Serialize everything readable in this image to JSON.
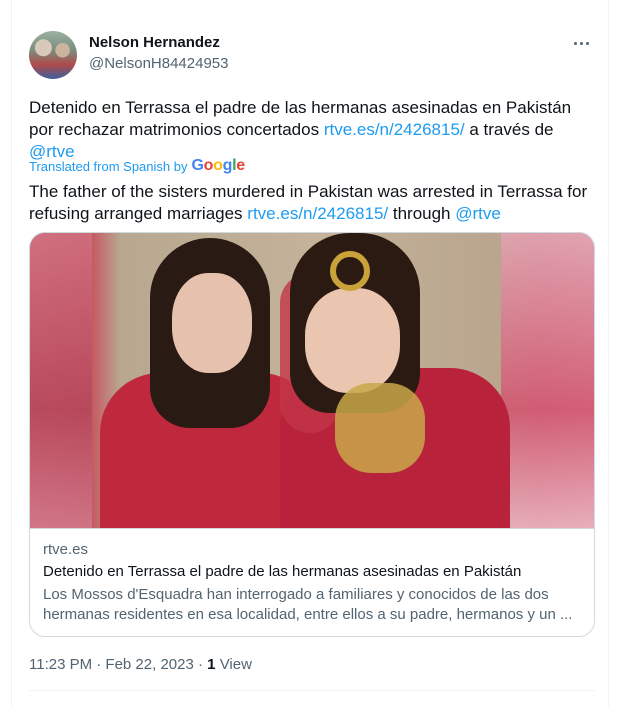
{
  "author": {
    "name": "Nelson Hernandez",
    "handle": "@NelsonH84424953"
  },
  "tweet": {
    "original_text": "Detenido en Terrassa el padre de las hermanas asesinadas en Pakistán por rechazar matrimonios concertados",
    "original_link": "rtve.es/n/2426815/",
    "original_via": "a través de",
    "original_mention": "@rtve",
    "translated_label": "Translated from Spanish by",
    "translator": "Google",
    "translated_text": "The father of the sisters murdered in Pakistan was arrested in Terrassa for refusing arranged marriages",
    "translated_link": "rtve.es/n/2426815/",
    "translated_via": "through",
    "translated_mention": "@rtve"
  },
  "preview": {
    "domain": "rtve.es",
    "title": "Detenido en Terrassa el padre de las hermanas asesinadas en Pakistán",
    "description": "Los Mossos d'Esquadra han interrogado a familiares y conocidos de las dos hermanas residentes en esa localidad, entre ellos a su padre, hermanos y un ..."
  },
  "footer": {
    "time": "11:23 PM · Feb 22, 2023 ·",
    "views_count": "1",
    "views_label": "View"
  },
  "colors": {
    "link": "#1d9bf0",
    "secondary_text": "#536471",
    "border": "#cfd9de"
  },
  "icons": [
    "more-icon",
    "google-logo"
  ]
}
